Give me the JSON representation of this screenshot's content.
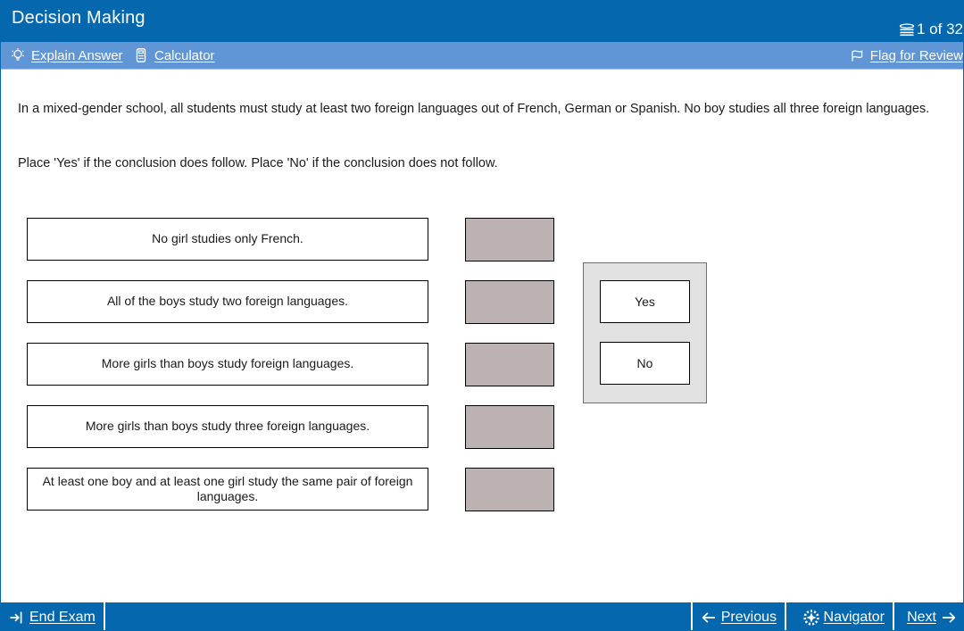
{
  "header": {
    "title": "Decision Making",
    "pages_icon": "pages-icon",
    "page_indicator": "1 of 32"
  },
  "toolbar": {
    "explain": {
      "label": "Explain Answer",
      "icon": "lightbulb-icon"
    },
    "calculator": {
      "label": "Calculator",
      "icon": "calculator-icon"
    },
    "flag": {
      "label": "Flag for Review",
      "icon": "flag-icon"
    }
  },
  "question": {
    "stem": "In a mixed-gender school, all students must study at least two foreign languages out of French, German or Spanish. No boy studies all three foreign languages.",
    "instruction": "Place 'Yes' if the conclusion does follow. Place 'No' if the conclusion does not follow."
  },
  "statements": [
    {
      "text": "No girl studies only French.",
      "answer": ""
    },
    {
      "text": "All of the boys study two foreign languages.",
      "answer": ""
    },
    {
      "text": "More girls than boys study foreign languages.",
      "answer": ""
    },
    {
      "text": "More girls than boys study three foreign languages.",
      "answer": ""
    },
    {
      "text": "At least one boy and at least one girl study the same pair of foreign languages.",
      "answer": ""
    }
  ],
  "palette": {
    "options": [
      {
        "label": "Yes"
      },
      {
        "label": "No"
      }
    ]
  },
  "footer": {
    "end_exam": {
      "label": "End Exam",
      "icon": "exit-icon"
    },
    "previous": {
      "label": "Previous",
      "icon": "arrow-left-icon"
    },
    "navigator": {
      "label": "Navigator",
      "icon": "compass-icon"
    },
    "next": {
      "label": "Next",
      "icon": "arrow-right-icon"
    }
  },
  "colors": {
    "title_bar": "#0568ae",
    "toolbar": "#6096d6",
    "drop_zone": "#bdb2b2",
    "palette_bg": "#e1e1e1"
  }
}
